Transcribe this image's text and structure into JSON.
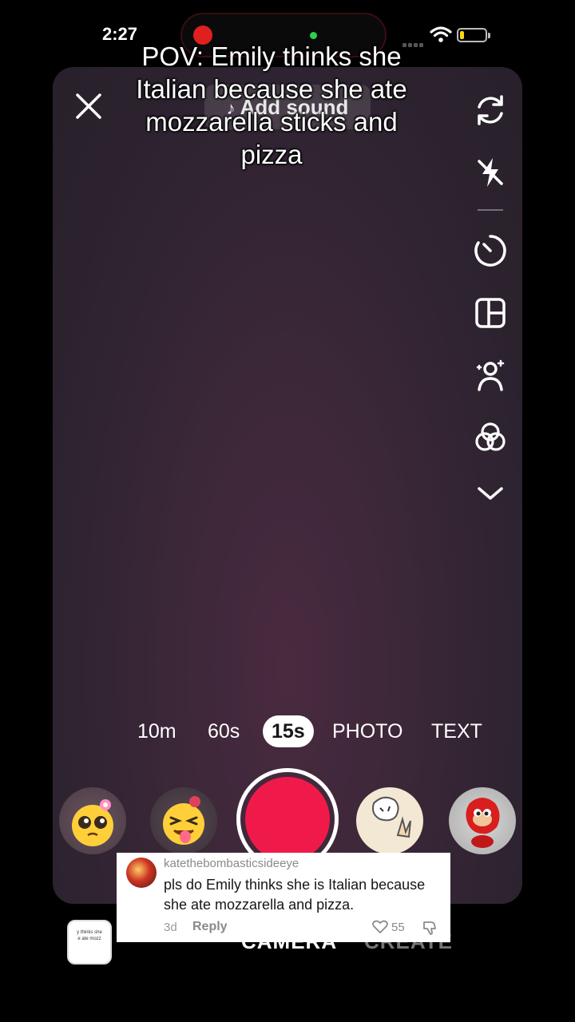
{
  "status_bar": {
    "time": "2:27"
  },
  "camera": {
    "add_sound_label": "Add sound",
    "caption": "POV: Emily thinks she Italian because she ate mozzarella sticks and pizza",
    "side_tools": [
      "flip-icon",
      "flash-icon",
      "timer-icon",
      "layout-icon",
      "retouch-icon",
      "filters-icon",
      "chevron-down-icon"
    ],
    "modes": [
      {
        "label": "10m",
        "active": false
      },
      {
        "label": "60s",
        "active": false
      },
      {
        "label": "15s",
        "active": true
      },
      {
        "label": "PHOTO",
        "active": false
      },
      {
        "label": "TEXT",
        "active": false
      }
    ],
    "record_color": "#f01a4a"
  },
  "bottom_nav": {
    "camera": "CAMERA",
    "create": "CREATE"
  },
  "gallery_thumb_text": "y thinks she\ne ate mozz",
  "comment": {
    "username": "katethebombasticsideeye",
    "text": "pls do Emily thinks she is Italian because she ate mozzarella and pizza.",
    "time": "3d",
    "reply_label": "Reply",
    "likes": "55"
  }
}
